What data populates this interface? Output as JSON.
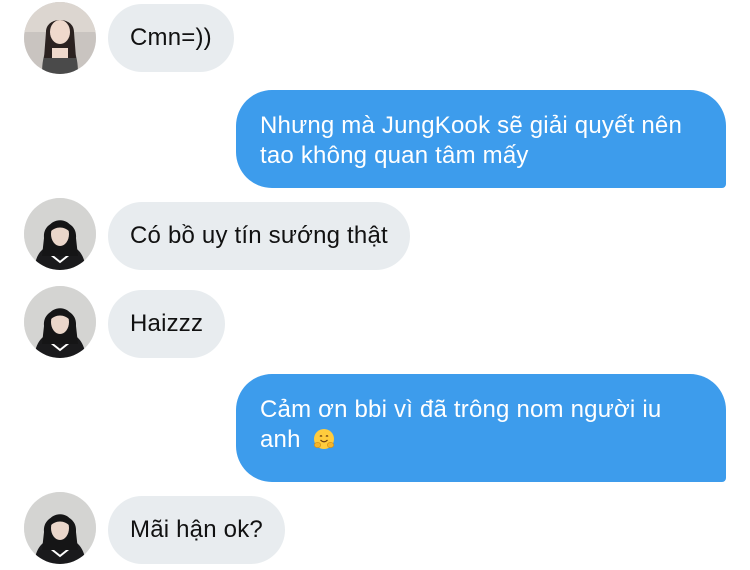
{
  "messages": [
    {
      "sender": "friend-1",
      "direction": "incoming",
      "text": "Cmn=))"
    },
    {
      "sender": "me",
      "direction": "outgoing",
      "text": "Nhưng mà JungKook sẽ giải quyết nên tao không quan tâm mấy"
    },
    {
      "sender": "friend-2",
      "direction": "incoming",
      "text": "Có bồ uy tín sướng thật"
    },
    {
      "sender": "friend-2",
      "direction": "incoming",
      "text": "Haizzz"
    },
    {
      "sender": "me",
      "direction": "outgoing",
      "text": "Cảm ơn bbi vì đã trông nom người iu anh",
      "emoji": "hugging-face-emoji"
    },
    {
      "sender": "friend-2",
      "direction": "incoming",
      "text": "Mãi hận ok?"
    }
  ],
  "colors": {
    "outgoing_bubble": "#3d9cec",
    "incoming_bubble": "#e8ecef",
    "incoming_text": "#111111",
    "outgoing_text": "#ffffff",
    "background": "#ffffff"
  }
}
